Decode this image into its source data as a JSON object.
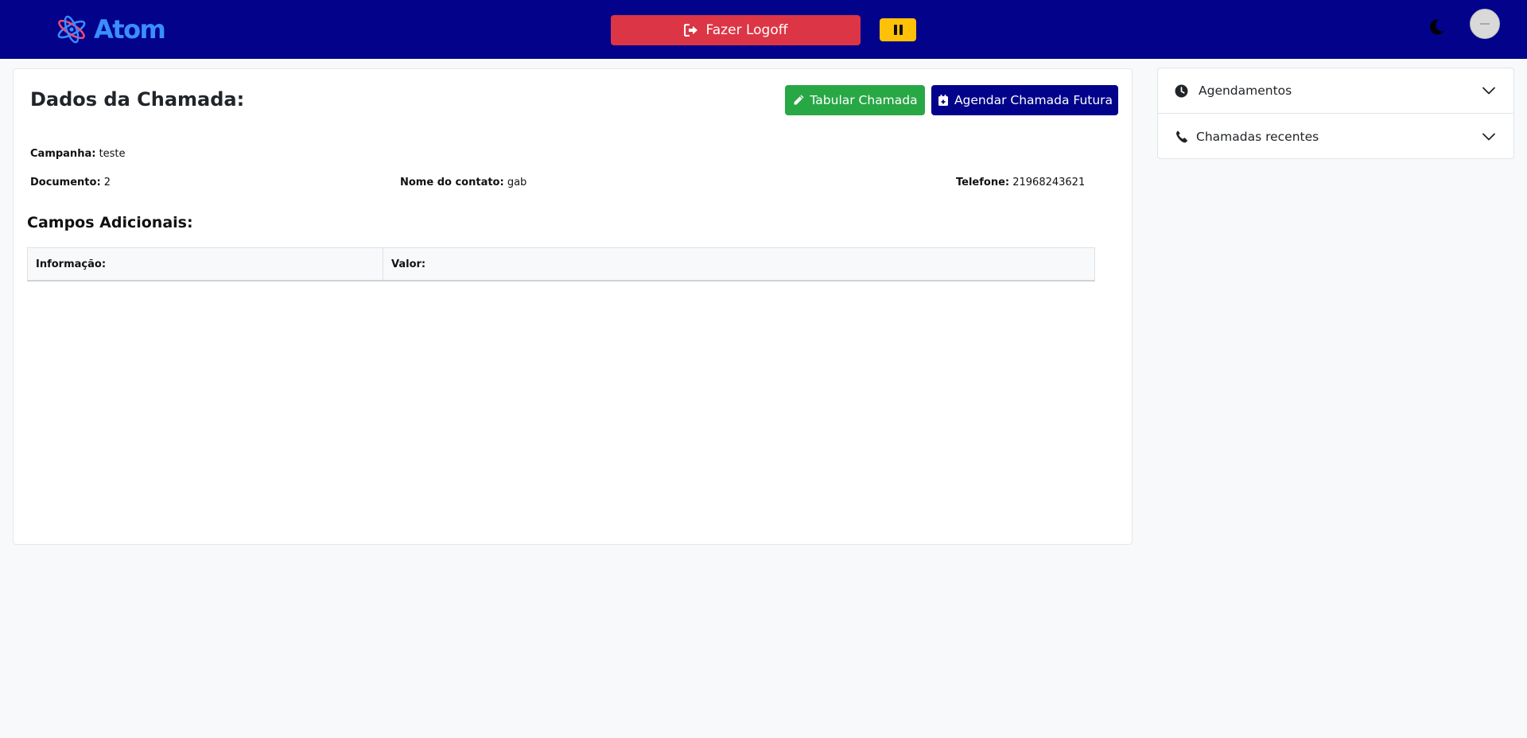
{
  "header": {
    "logo_text": "Atom",
    "logoff_label": "Fazer Logoff"
  },
  "call": {
    "title": "Dados da Chamada:",
    "tabular_label": "Tabular Chamada",
    "agendar_label": "Agendar Chamada Futura",
    "fields": {
      "campanha_label": "Campanha:",
      "campanha_value": "teste",
      "documento_label": "Documento:",
      "documento_value": "2",
      "nome_label": "Nome do contato:",
      "nome_value": "gab",
      "telefone_label": "Telefone:",
      "telefone_value": "21968243621"
    },
    "extra_title": "Campos Adicionais:",
    "table_headers": [
      "Informação:",
      "Valor:"
    ]
  },
  "sidebar": {
    "items": [
      {
        "label": "Agendamentos",
        "icon": "clock-icon"
      },
      {
        "label": "Chamadas recentes",
        "icon": "phone-icon"
      }
    ]
  },
  "colors": {
    "navbar": "#02028a",
    "danger": "#dc3545",
    "warning": "#ffc107",
    "success": "#28a745",
    "primary": "#02028a",
    "logo": "#3a8dff"
  }
}
